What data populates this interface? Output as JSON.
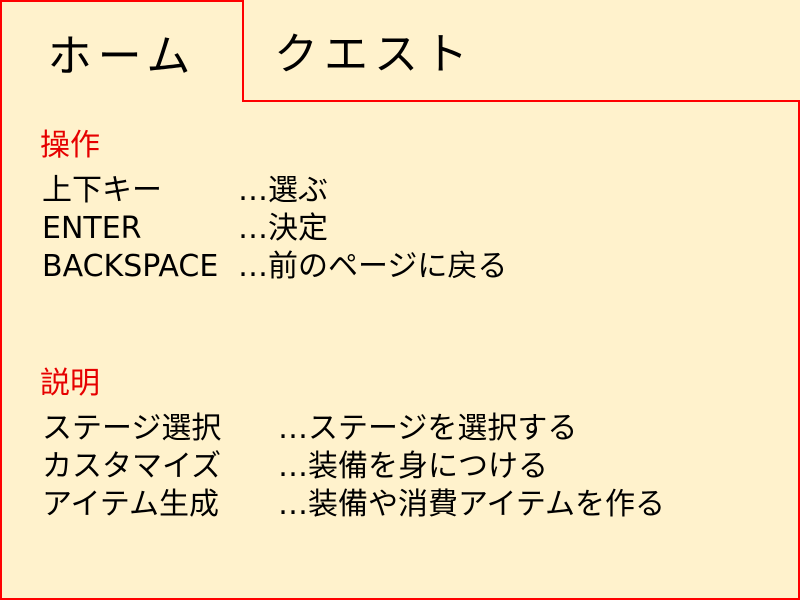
{
  "tabs": [
    {
      "label": "ホーム",
      "active": true
    },
    {
      "label": "クエスト",
      "active": false
    }
  ],
  "colors": {
    "background": "#fff2cc",
    "border": "#ff0000",
    "heading": "#e60000",
    "text": "#000000"
  },
  "controls": {
    "title": "操作",
    "items": [
      {
        "key": "上下キー",
        "desc": "…選ぶ"
      },
      {
        "key": "ENTER",
        "desc": "…決定"
      },
      {
        "key": "BACKSPACE",
        "desc": "…前のページに戻る"
      }
    ]
  },
  "explanation": {
    "title": "説明",
    "items": [
      {
        "key": "ステージ選択",
        "desc": "…ステージを選択する"
      },
      {
        "key": "カスタマイズ",
        "desc": "…装備を身につける"
      },
      {
        "key": "アイテム生成",
        "desc": "…装備や消費アイテムを作る"
      }
    ]
  }
}
